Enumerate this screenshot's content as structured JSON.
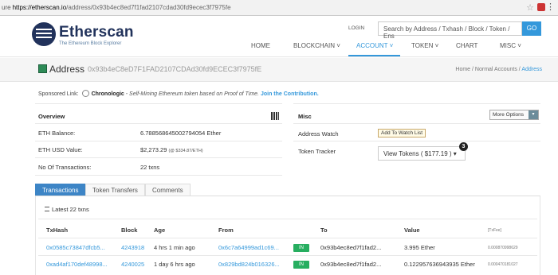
{
  "browser": {
    "protocol": "ure",
    "url_host": "https://etherscan.io",
    "url_path": "/address/0x93b4ec8ed7f1fad2107cdad30fd9ecec3f7975fe"
  },
  "header": {
    "brand": "Etherscan",
    "tagline": "The Ethereum Block Explorer",
    "login_label": "LOGIN",
    "search_placeholder": "Search by Address / Txhash / Block / Token / Ens",
    "go_label": "GO",
    "nav": [
      {
        "label": "HOME"
      },
      {
        "label": "BLOCKCHAIN ˅"
      },
      {
        "label": "ACCOUNT ˅"
      },
      {
        "label": "TOKEN ˅"
      },
      {
        "label": "CHART"
      },
      {
        "label": "MISC ˅"
      }
    ]
  },
  "page": {
    "title": "Address",
    "address": "0x93b4eC8eD7F1FAD2107CDAd30fd9ECEC3f7975fE",
    "breadcrumb": [
      "Home",
      "Normal Accounts",
      "Address"
    ]
  },
  "sponsored": {
    "label": "Sponsored Link:",
    "name": "Chronologic",
    "description": " - Self-Mining Ethereum token based on Proof of Time. ",
    "cta": "Join the Contribution."
  },
  "overview": {
    "heading": "Overview",
    "balance_label": "ETH Balance:",
    "balance_value": "6.788568645002794054 Ether",
    "usd_label": "ETH USD Value:",
    "usd_value": "$2,273.29 ",
    "usd_rate": "(@ $334.87/ETH)",
    "tx_label": "No Of Transactions:",
    "tx_value": "22 txns"
  },
  "misc": {
    "heading": "Misc",
    "more_options": "More Options",
    "watch_label": "Address Watch",
    "watch_button": "Add To Watch List",
    "tracker_label": "Token Tracker",
    "tracker_button": "View Tokens ( $177.19 ) ▾",
    "badge": "3"
  },
  "tabs": [
    {
      "label": "Transactions"
    },
    {
      "label": "Token Transfers"
    },
    {
      "label": "Comments"
    }
  ],
  "table": {
    "summary": "Latest 22 txns",
    "headers": [
      "TxHash",
      "Block",
      "Age",
      "From",
      "",
      "To",
      "Value",
      "[TxFee]"
    ],
    "rows": [
      {
        "hash": "0x0585c73847dfcb5...",
        "block": "4243918",
        "age": "4 hrs 1 min ago",
        "from": "0x6c7a64999ad1c69...",
        "dir": "IN",
        "to": "0x93b4ec8ed7f1fad2...",
        "value": "3.995 Ether",
        "fee": "0.000870998629"
      },
      {
        "hash": "0xad4af170def48998...",
        "block": "4240025",
        "age": "1 day 6 hrs ago",
        "from": "0x829bd824b016326...",
        "dir": "IN",
        "to": "0x93b4ec8ed7f1fad2...",
        "value": "0.122957636943935 Ether",
        "fee": "0.000470181027"
      }
    ]
  }
}
